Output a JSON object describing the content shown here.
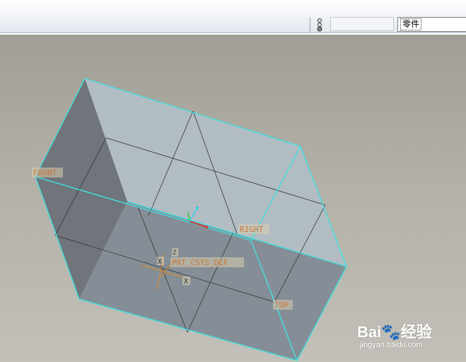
{
  "toolbar": {
    "filter_select_value": "零件",
    "filter_icon": "selection-filter-icon",
    "blank_field_value": ""
  },
  "viewport": {
    "datum_labels": {
      "front": "FRONT",
      "right": "RIGHT",
      "top": "TOP",
      "csys": "PRT_CSYS_DEF"
    },
    "axis_labels": {
      "x_small": "X",
      "z_small": "Z",
      "x_axis": "X"
    },
    "colors": {
      "edge_highlight": "#40e0e0",
      "label_text": "#c8783c",
      "label_bg": "#d8cdb0"
    }
  },
  "watermark": {
    "logo_text": "Bai",
    "logo_suffix": "经验",
    "url": "jingyan.baidu.com"
  }
}
